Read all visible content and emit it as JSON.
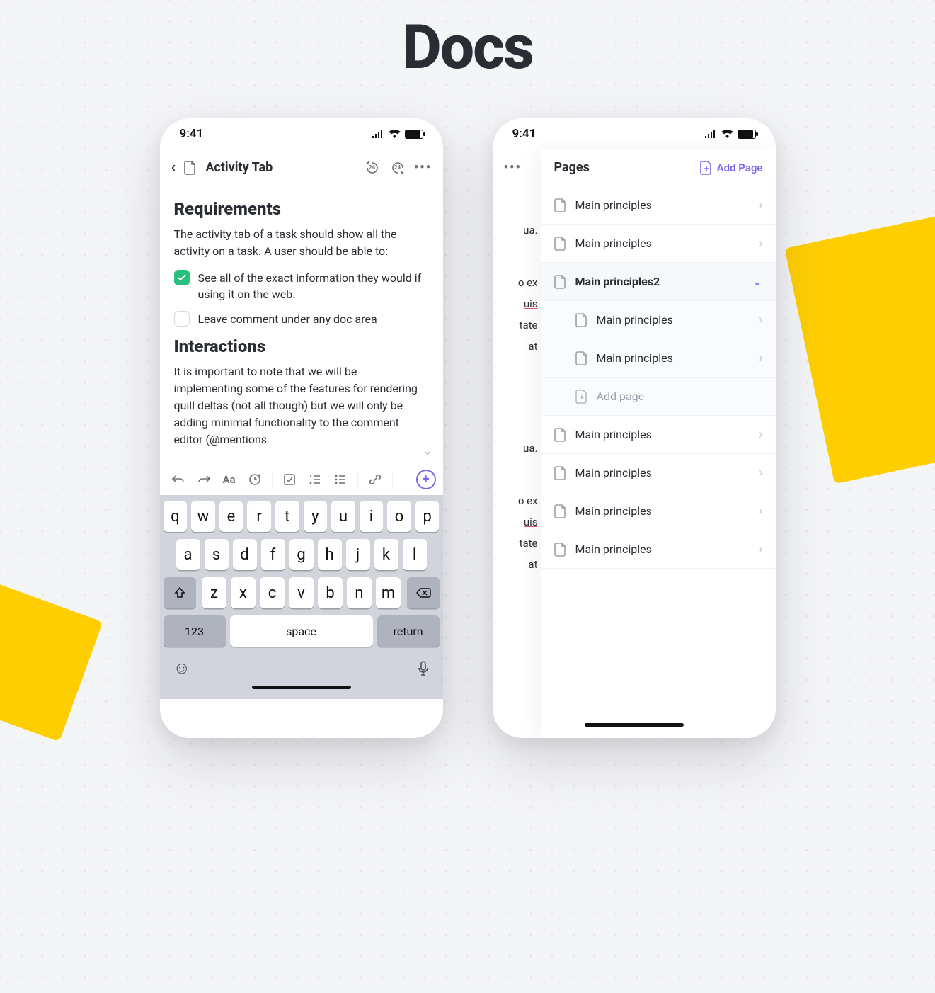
{
  "page_title": "Docs",
  "status": {
    "time": "9:41"
  },
  "phone1": {
    "header": {
      "title": "Activity Tab",
      "badge1": "24",
      "badge2": "24"
    },
    "section1": {
      "heading": "Requirements",
      "body": "The activity tab of a task should show all the activity on a task. A user should be able to:",
      "checks": [
        {
          "checked": true,
          "label": "See all of the exact information they would if using it on the web."
        },
        {
          "checked": false,
          "label": "Leave comment under any doc area"
        }
      ]
    },
    "section2": {
      "heading": "Interactions",
      "body": "It is important to note that we will be implementing some of the features for rendering quill deltas (not all though) but we will only be adding minimal functionality to the comment editor (@mentions"
    },
    "toolbar": [
      "undo",
      "redo",
      "text-style",
      "mention",
      "checklist",
      "numbered-list",
      "bulleted-list",
      "link",
      "add"
    ],
    "keyboard": {
      "row1": [
        "q",
        "w",
        "e",
        "r",
        "t",
        "y",
        "u",
        "i",
        "o",
        "p"
      ],
      "row2": [
        "a",
        "s",
        "d",
        "f",
        "g",
        "h",
        "j",
        "k",
        "l"
      ],
      "row3": [
        "z",
        "x",
        "c",
        "v",
        "b",
        "n",
        "m"
      ],
      "num_key": "123",
      "space_key": "space",
      "return_key": "return"
    }
  },
  "phone2": {
    "drawer_title": "Pages",
    "add_page_label": "Add Page",
    "add_subpage_label": "Add page",
    "bg_fragments": [
      "ua.",
      "o ex",
      "uis",
      "tate",
      "at",
      "ua.",
      "o ex",
      "uis",
      "tate",
      "at"
    ],
    "pages": [
      {
        "label": "Main principles",
        "selected": false,
        "child": false
      },
      {
        "label": "Main principles",
        "selected": false,
        "child": false
      },
      {
        "label": "Main principles2",
        "selected": true,
        "child": false
      },
      {
        "label": "Main principles",
        "selected": false,
        "child": true
      },
      {
        "label": "Main principles",
        "selected": false,
        "child": true
      },
      {
        "label": "Main principles",
        "selected": false,
        "child": false
      },
      {
        "label": "Main principles",
        "selected": false,
        "child": false
      },
      {
        "label": "Main principles",
        "selected": false,
        "child": false
      },
      {
        "label": "Main principles",
        "selected": false,
        "child": false
      }
    ]
  }
}
